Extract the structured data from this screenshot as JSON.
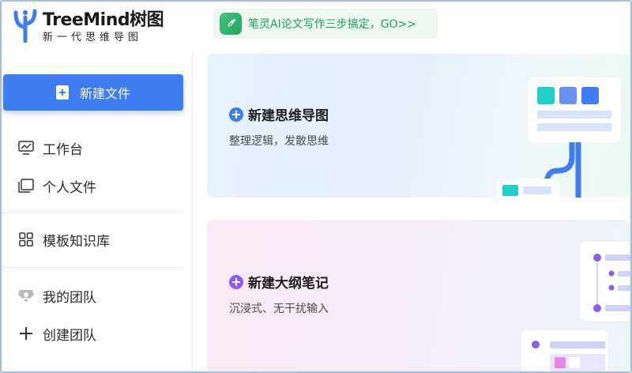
{
  "header": {
    "brand": "TreeMind树图",
    "tagline": "新一代思维导图",
    "promo_text": "笔灵AI论文写作三步搞定，GO>>"
  },
  "sidebar": {
    "new_file_label": "新建文件",
    "items": [
      {
        "label": "工作台",
        "icon": "monitor-icon"
      },
      {
        "label": "个人文件",
        "icon": "folder-icon"
      },
      {
        "label": "模板知识库",
        "icon": "grid-icon"
      },
      {
        "label": "我的团队",
        "icon": "team-icon"
      },
      {
        "label": "创建团队",
        "icon": "plus-icon"
      }
    ]
  },
  "main": {
    "cards": [
      {
        "title": "新建思维导图",
        "subtitle": "整理逻辑，发散思维",
        "accent": "#3f7cf0"
      },
      {
        "title": "新建大纲笔记",
        "subtitle": "沉浸式、无干扰输入",
        "accent": "#8b5cf6"
      }
    ]
  },
  "colors": {
    "primary": "#3f7cf0",
    "promo_green": "#1aa160",
    "purple": "#8b5cf6"
  }
}
